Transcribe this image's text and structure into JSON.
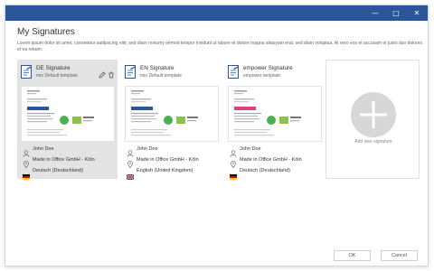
{
  "dialog": {
    "title": "My Signatures",
    "description": "Lorem ipsum dolor sit amet, consetetur sadipscing elitr, sed diam nonumy eirmod tempor invidunt ut labore et dolore magna aliquyam erat, sed diam voluptua. At vero eos et accusam et justo duo dolores et ea rebum."
  },
  "window_controls": {
    "minimize": "—",
    "maximize": "□",
    "close": "✕"
  },
  "cards": [
    {
      "name": "DE Signature",
      "template": "mio Default template",
      "user": "John Doe",
      "company": "Made in Office GmbH - Köln",
      "language": "Deutsch (Deutschland)",
      "flag": "de",
      "selected": true,
      "logo": "made in office"
    },
    {
      "name": "EN Signature",
      "template": "mio Default template",
      "user": "John Doe",
      "company": "Made in Office GmbH - Köln",
      "language": "English (United Kingdom)",
      "flag": "uk",
      "selected": false,
      "logo": "made in office"
    },
    {
      "name": "empower Signature",
      "template": "empower template",
      "user": "John Doe",
      "company": "Made in Office GmbH - Köln",
      "language": "Deutsch (Deutschland)",
      "flag": "de",
      "selected": false,
      "logo": "empower studio"
    }
  ],
  "add_card": {
    "label": "Add new signature"
  },
  "buttons": {
    "ok": "OK",
    "cancel": "Cancel"
  },
  "colors": {
    "titlebar": "#2b579a",
    "selected_card": "#e3e3e3",
    "accent": "#2b579a"
  },
  "icons": [
    "signature-document-icon",
    "pencil-icon",
    "trash-icon",
    "person-icon",
    "location-pin-icon",
    "flag-icon",
    "plus-icon"
  ]
}
